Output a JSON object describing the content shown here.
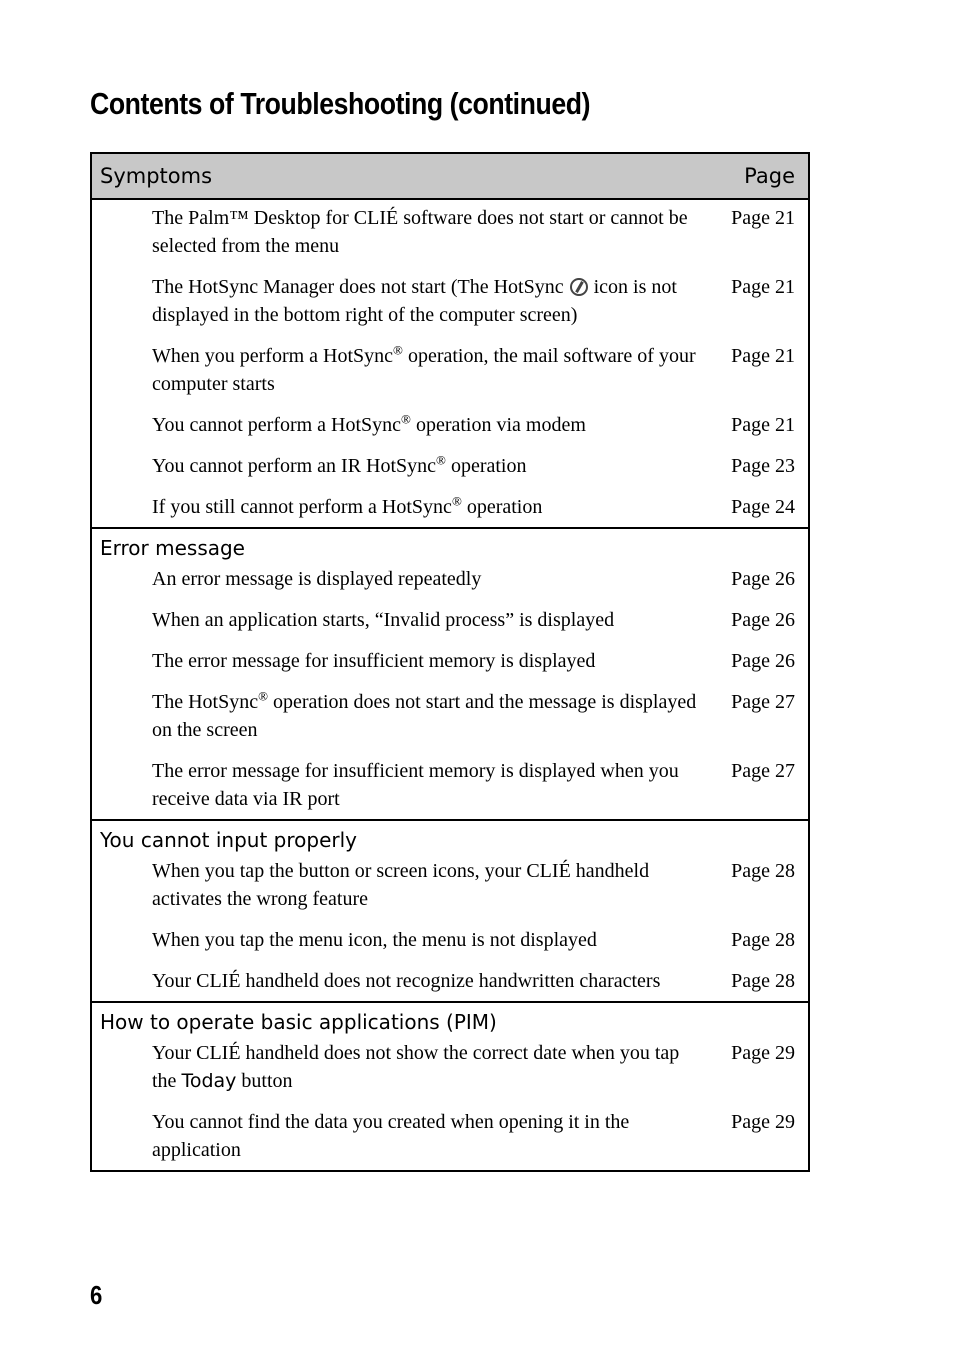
{
  "title": "Contents of Troubleshooting (continued)",
  "table": {
    "header": {
      "symptoms": "Symptoms",
      "page": "Page"
    },
    "sections": [
      {
        "title": "",
        "rows": [
          {
            "text": "The Palm™ Desktop for CLIÉ software does not start or cannot be selected from the menu",
            "page": "Page 21"
          },
          {
            "text_before": "The HotSync Manager does not start (The HotSync",
            "icon": "hotsync-icon",
            "text_after": "icon is not displayed in the bottom right of the computer screen)",
            "page": "Page 21"
          },
          {
            "text_before": "When you perform a HotSync",
            "sup": "®",
            "text_after": " operation, the mail software of your computer starts",
            "page": "Page 21"
          },
          {
            "text_before": "You cannot perform a HotSync",
            "sup": "®",
            "text_after": " operation via modem",
            "page": "Page 21"
          },
          {
            "text_before": "You cannot perform an IR HotSync",
            "sup": "®",
            "text_after": " operation",
            "page": "Page 23"
          },
          {
            "text_before": "If you still cannot perform a HotSync",
            "sup": "®",
            "text_after": " operation",
            "page": "Page 24"
          }
        ]
      },
      {
        "title": "Error message",
        "rows": [
          {
            "text": "An error message is displayed repeatedly",
            "page": "Page 26"
          },
          {
            "text": "When an application starts, “Invalid process” is displayed",
            "page": "Page 26"
          },
          {
            "text": "The error message for insufficient memory is displayed",
            "page": "Page 26"
          },
          {
            "text_before": "The HotSync",
            "sup": "®",
            "text_after": " operation does not start and the message is displayed on the screen",
            "page": "Page 27"
          },
          {
            "text": "The error message for insufficient memory is displayed when you receive data via IR port",
            "page": "Page 27"
          }
        ]
      },
      {
        "title": "You cannot input properly",
        "rows": [
          {
            "text": "When you tap the button or screen icons, your CLIÉ handheld activates the wrong feature",
            "page": "Page 28"
          },
          {
            "text": "When you tap the menu icon, the menu is not displayed",
            "page": "Page 28"
          },
          {
            "text": "Your CLIÉ handheld does not recognize handwritten characters",
            "page": "Page 28"
          }
        ]
      },
      {
        "title": "How to operate basic applications (PIM)",
        "rows": [
          {
            "text_before": "Your CLIÉ handheld does not show the correct date when you tap the ",
            "ui_word": "Today",
            "text_after": " button",
            "page": "Page 29"
          },
          {
            "text": "You cannot find the data you created when opening it in the application",
            "page": "Page 29"
          }
        ]
      }
    ]
  },
  "page_number": "6"
}
